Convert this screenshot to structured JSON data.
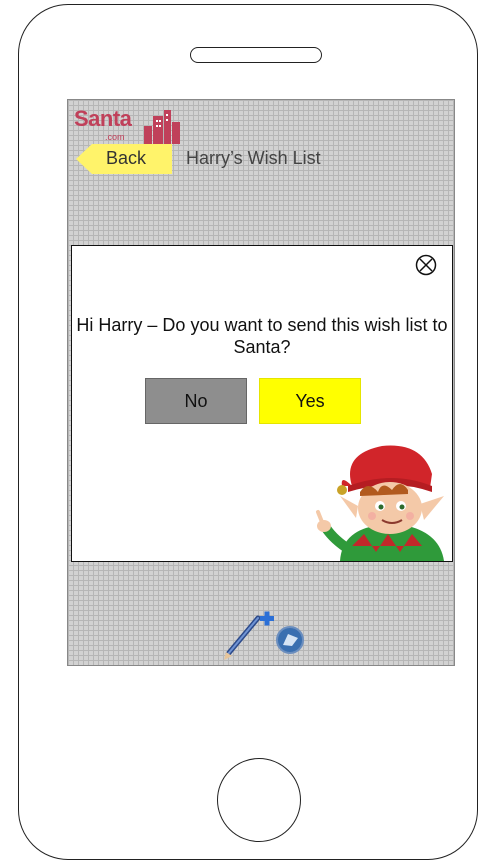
{
  "header": {
    "logo_text": "Santa",
    "logo_sub": ".com",
    "back_label": "Back",
    "title": "Harry’s Wish List"
  },
  "dialog": {
    "message": "Hi Harry – Do you want to send this wish list to Santa?",
    "no_label": "No",
    "yes_label": "Yes",
    "close_icon": "close-circle-x-icon",
    "mascot": "elf-illustration"
  },
  "toolbar": {
    "icon": "edit-add-icon"
  },
  "colors": {
    "yes": "#ffff00",
    "no": "#8e8e8e",
    "back": "#fff36a",
    "brand": "#c0405a"
  }
}
